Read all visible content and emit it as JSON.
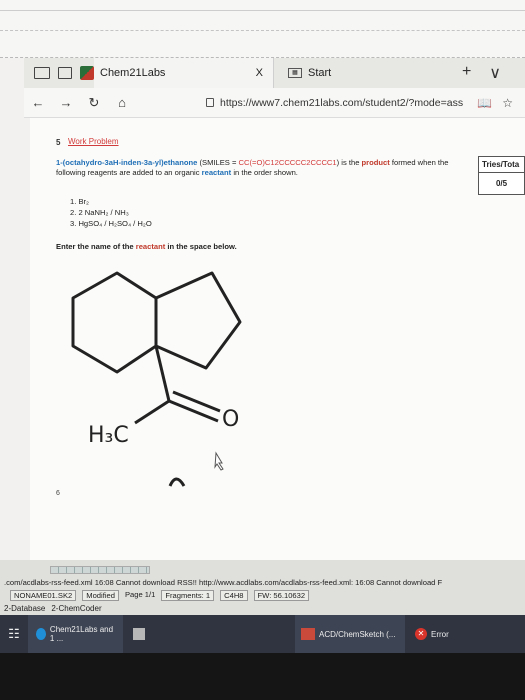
{
  "browser": {
    "tabs": [
      {
        "label": "Chem21Labs",
        "close": "X"
      },
      {
        "label": "Start"
      }
    ],
    "new_tab": "+",
    "tab_menu": "∨",
    "nav": {
      "back": "←",
      "forward": "→",
      "refresh": "↻",
      "home": "⌂"
    },
    "address": "https://www7.chem21labs.com/student2/?mode=ass",
    "reading_view": "📖",
    "favorite": "☆"
  },
  "problem": {
    "number": "5",
    "link": "Work Problem",
    "compound": "1-(octahydro-3aH-inden-3a-yl)ethanone",
    "smiles_prefix": "(SMILES = ",
    "smiles": "CC(=O)C12CCCCC2CCCC1",
    "smiles_suffix": ")",
    "text1": " is the ",
    "product": "product",
    "text2": " formed when the following reagents are added to an organic ",
    "reactant": "reactant",
    "text3": " in the order shown.",
    "reagents": [
      "1.  Br₂",
      "2.  2 NaNH₂ / NH₃",
      "3.  HgSO₄ / H₂SO₄ / H₂O"
    ],
    "prompt_start": "Enter the name of the ",
    "prompt_reactant": "reactant",
    "prompt_end": " in the space below.",
    "structure_label_methyl": "H₃C",
    "structure_label_oxygen": "O",
    "next_number": "6",
    "tries_header": "Tries/Tota",
    "tries_value": "0/5"
  },
  "chemsketch_status": {
    "url_left": ".com/acdlabs-rss-feed.xml",
    "message": "16:08 Cannot download RSS!! http://www.acdlabs.com/acdlabs-rss-feed.xml: 16:08 Cannot download F",
    "doc_name": "NONAME01.SK2",
    "modified": "Modified",
    "page": "Page 1/1",
    "fragments": "Fragments: 1",
    "formula": "C4H8",
    "fw": "FW: 56.10632",
    "db_tab": "2-Database",
    "coder_tab": "2-ChemCoder"
  },
  "taskbar": {
    "edge": "Chem21Labs and 1 ...",
    "acd": "ACD/ChemSketch (...",
    "error": "Error"
  }
}
